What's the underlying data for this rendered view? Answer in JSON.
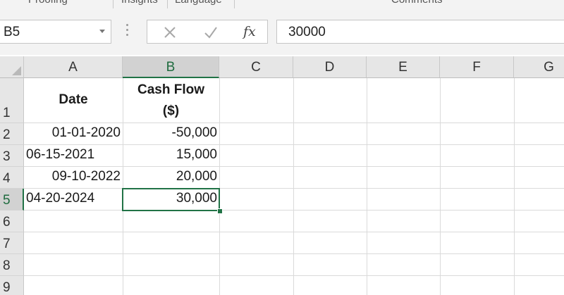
{
  "ribbon": {
    "groups": [
      "Proofing",
      "Insights",
      "Language",
      "Comments"
    ]
  },
  "formula_bar": {
    "name_box": "B5",
    "cancel_icon": "x-icon",
    "enter_icon": "check-icon",
    "fx_label": "fx",
    "value": "30000"
  },
  "grid": {
    "columns": [
      "A",
      "B",
      "C",
      "D",
      "E",
      "F",
      "G"
    ],
    "rows": [
      "1",
      "2",
      "3",
      "4",
      "5",
      "6",
      "7",
      "8",
      "9"
    ],
    "active_cell": "B5",
    "header": {
      "a1": "Date",
      "b1_line1": "Cash Flow",
      "b1_line2": "($)"
    },
    "data": [
      {
        "date": "01-01-2020",
        "cash_flow": "-50,000"
      },
      {
        "date": "06-15-2021",
        "cash_flow": "15,000"
      },
      {
        "date": "09-10-2022",
        "cash_flow": "20,000"
      },
      {
        "date": "04-20-2024",
        "cash_flow": "30,000"
      }
    ]
  },
  "colors": {
    "accent": "#217346",
    "header_bg": "#e6e6e6",
    "gridline": "#dadada"
  }
}
